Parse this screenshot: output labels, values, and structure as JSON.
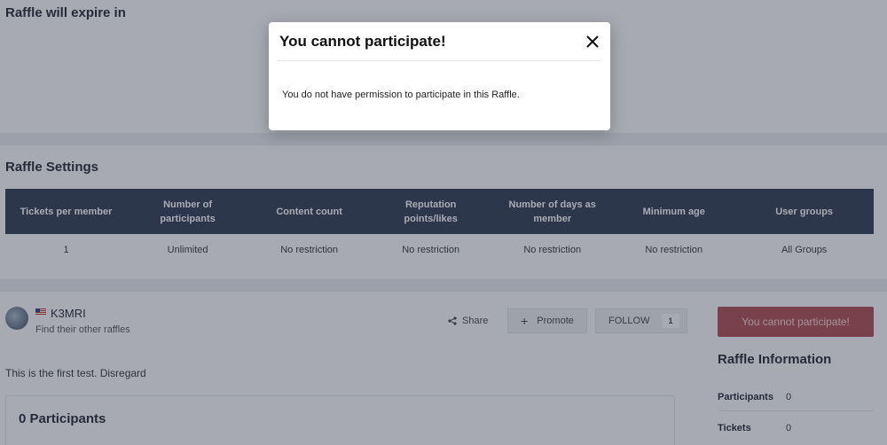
{
  "expire": {
    "title": "Raffle will expire in"
  },
  "settings": {
    "title": "Raffle Settings",
    "headers": [
      "Tickets per member",
      "Number of participants",
      "Content count",
      "Reputation points/likes",
      "Number of days as member",
      "Minimum age",
      "User groups"
    ],
    "values": [
      "1",
      "Unlimited",
      "No restriction",
      "No restriction",
      "No restriction",
      "No restriction",
      "All Groups"
    ]
  },
  "author": {
    "username": "K3MRI",
    "other_link": "Find their other raffles"
  },
  "actions": {
    "share_label": "Share",
    "promote_label": "Promote",
    "follow_label": "FOLLOW",
    "follow_count": "1",
    "participate_label": "You cannot participate!"
  },
  "description": "This is the first test. Disregard",
  "participants": {
    "title": "0 Participants"
  },
  "info": {
    "title": "Raffle Information",
    "rows": [
      {
        "label": "Participants",
        "value": "0"
      },
      {
        "label": "Tickets",
        "value": "0"
      }
    ]
  },
  "modal": {
    "title": "You cannot participate!",
    "message": "You do not have permission to participate in this Raffle."
  },
  "colors": {
    "table_header": "#2e3a50",
    "participate_button": "#b04a4f",
    "overlay": "#2d3448"
  },
  "icons": {
    "share": "share-icon",
    "promote": "plus-icon",
    "close": "close-icon"
  }
}
